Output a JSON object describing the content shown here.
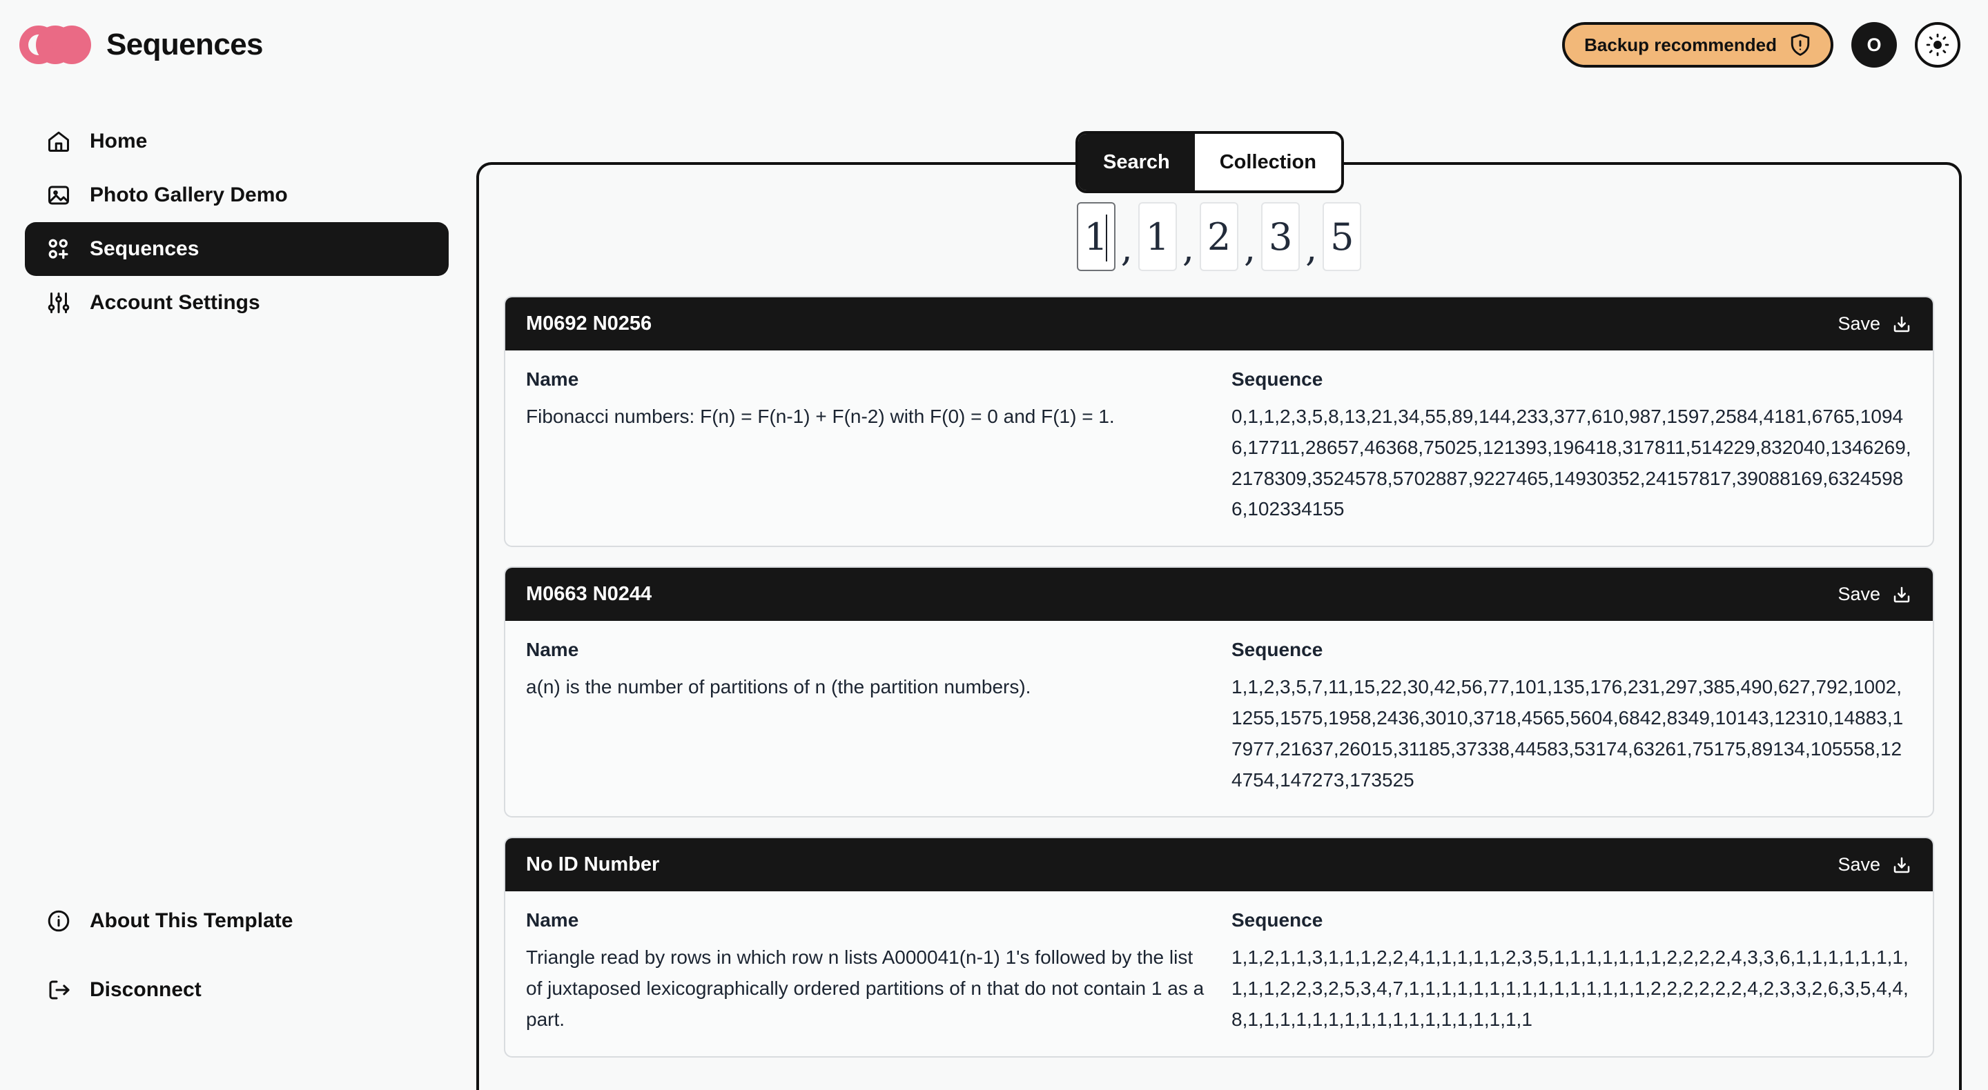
{
  "header": {
    "brand_title": "Sequences",
    "logo_icon": "three-circles-logo",
    "backup_pill": {
      "label": "Backup recommended",
      "icon": "shield-alert-icon",
      "bg_color": "#f2b879"
    },
    "avatar": {
      "initial": "O"
    },
    "theme_toggle": {
      "icon": "sun-icon"
    }
  },
  "sidebar": {
    "items": [
      {
        "label": "Home",
        "icon": "home-icon",
        "active": false
      },
      {
        "label": "Photo Gallery Demo",
        "icon": "image-icon",
        "active": false
      },
      {
        "label": "Sequences",
        "icon": "circles-plus-icon",
        "active": true
      },
      {
        "label": "Account Settings",
        "icon": "sliders-icon",
        "active": false
      }
    ],
    "bottom_items": [
      {
        "label": "About This Template",
        "icon": "info-circle-icon"
      },
      {
        "label": "Disconnect",
        "icon": "logout-icon"
      }
    ]
  },
  "main": {
    "tabs": [
      {
        "label": "Search",
        "active": true
      },
      {
        "label": "Collection",
        "active": false
      }
    ],
    "digit_input": {
      "digits": [
        "1",
        "1",
        "2",
        "3",
        "5"
      ],
      "focused_index": 0,
      "separator": ","
    },
    "column_headers": {
      "name": "Name",
      "sequence": "Sequence"
    },
    "save_label": "Save",
    "save_icon": "download-tray-icon",
    "cards": [
      {
        "id": "M0692 N0256",
        "name": "Fibonacci numbers: F(n) = F(n-1) + F(n-2) with F(0) = 0 and F(1) = 1.",
        "sequence": "0,1,1,2,3,5,8,13,21,34,55,89,144,233,377,610,987,1597,2584,4181,6765,10946,17711,28657,46368,75025,121393,196418,317811,514229,832040,1346269,2178309,3524578,5702887,9227465,14930352,24157817,39088169,63245986,102334155"
      },
      {
        "id": "M0663 N0244",
        "name": "a(n) is the number of partitions of n (the partition numbers).",
        "sequence": "1,1,2,3,5,7,11,15,22,30,42,56,77,101,135,176,231,297,385,490,627,792,1002,1255,1575,1958,2436,3010,3718,4565,5604,6842,8349,10143,12310,14883,17977,21637,26015,31185,37338,44583,53174,63261,75175,89134,105558,124754,147273,173525"
      },
      {
        "id": "No ID Number",
        "name": "Triangle read by rows in which row n lists A000041(n-1) 1's followed by the list of juxtaposed lexicographically ordered partitions of n that do not contain 1 as a part.",
        "sequence": "1,1,2,1,1,3,1,1,1,2,2,4,1,1,1,1,1,2,3,5,1,1,1,1,1,1,1,2,2,2,2,4,3,3,6,1,1,1,1,1,1,1,1,1,1,2,2,3,2,5,3,4,7,1,1,1,1,1,1,1,1,1,1,1,1,1,1,1,2,2,2,2,2,2,4,2,3,3,2,6,3,5,4,4,8,1,1,1,1,1,1,1,1,1,1,1,1,1,1,1,1,1,1"
      }
    ]
  }
}
